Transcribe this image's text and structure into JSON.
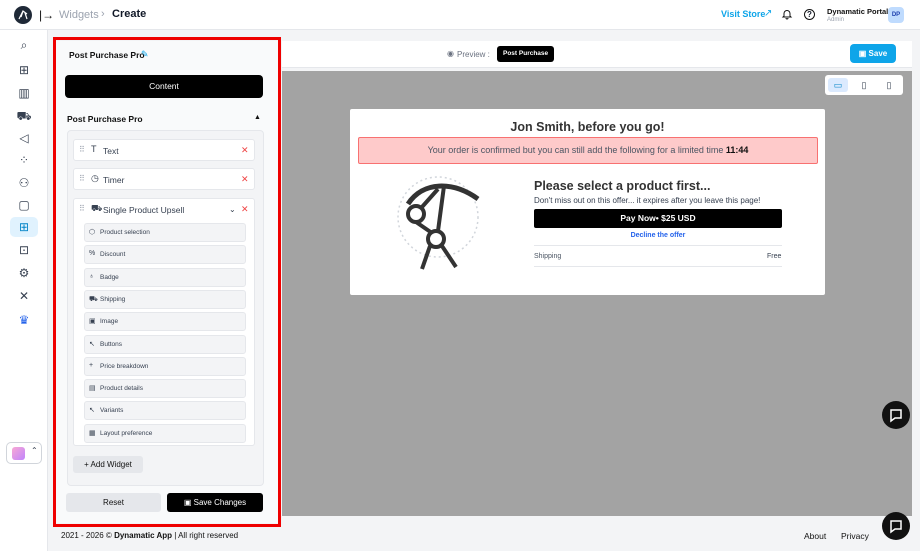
{
  "header": {
    "breadcrumb_parent": "Widgets",
    "breadcrumb_sep": "›",
    "breadcrumb_current": "Create",
    "visit_store": "Visit Store",
    "portal_name": "Dynamatic Portal",
    "portal_role": "Admin",
    "avatar_initials": "DP"
  },
  "panel": {
    "title": "Post Purchase Pro",
    "content_button": "Content",
    "section_title": "Post Purchase Pro",
    "widgets": [
      {
        "label": "Text",
        "icon": "T"
      },
      {
        "label": "Timer",
        "icon": "timer-icon"
      },
      {
        "label": "Single Product Upsell",
        "icon": "cart-icon"
      }
    ],
    "upsell_options": [
      "Product selection",
      "Discount",
      "Badge",
      "Shipping",
      "Image",
      "Buttons",
      "Price breakdown",
      "Product details",
      "Variants",
      "Layout preference"
    ],
    "add_widget": "+ Add Widget",
    "reset": "Reset",
    "save_changes": "Save Changes"
  },
  "preview": {
    "label": "Preview :",
    "mode": "Post Purchase",
    "save": "Save"
  },
  "upsell": {
    "heading": "Jon Smith, before you go!",
    "banner_text": "Your order is confirmed but you can still add the following for a limited time ",
    "banner_timer": "11:44",
    "product_title": "Please select a product first...",
    "product_sub": "Don't miss out on this offer... it expires after you leave this page!",
    "pay_button": "Pay Now• $25 USD",
    "decline": "Decline the offer",
    "shipping_label": "Shipping",
    "shipping_value": "Free"
  },
  "footer": {
    "copyright_prefix": "2021 - 2026 ©",
    "brand": "Dynamatic App",
    "suffix": "| All right reserved",
    "about": "About",
    "privacy": "Privacy"
  },
  "colors": {
    "accent": "#0ea5e9",
    "highlight_frame": "#ef0000",
    "banner_bg": "#fecaca"
  }
}
